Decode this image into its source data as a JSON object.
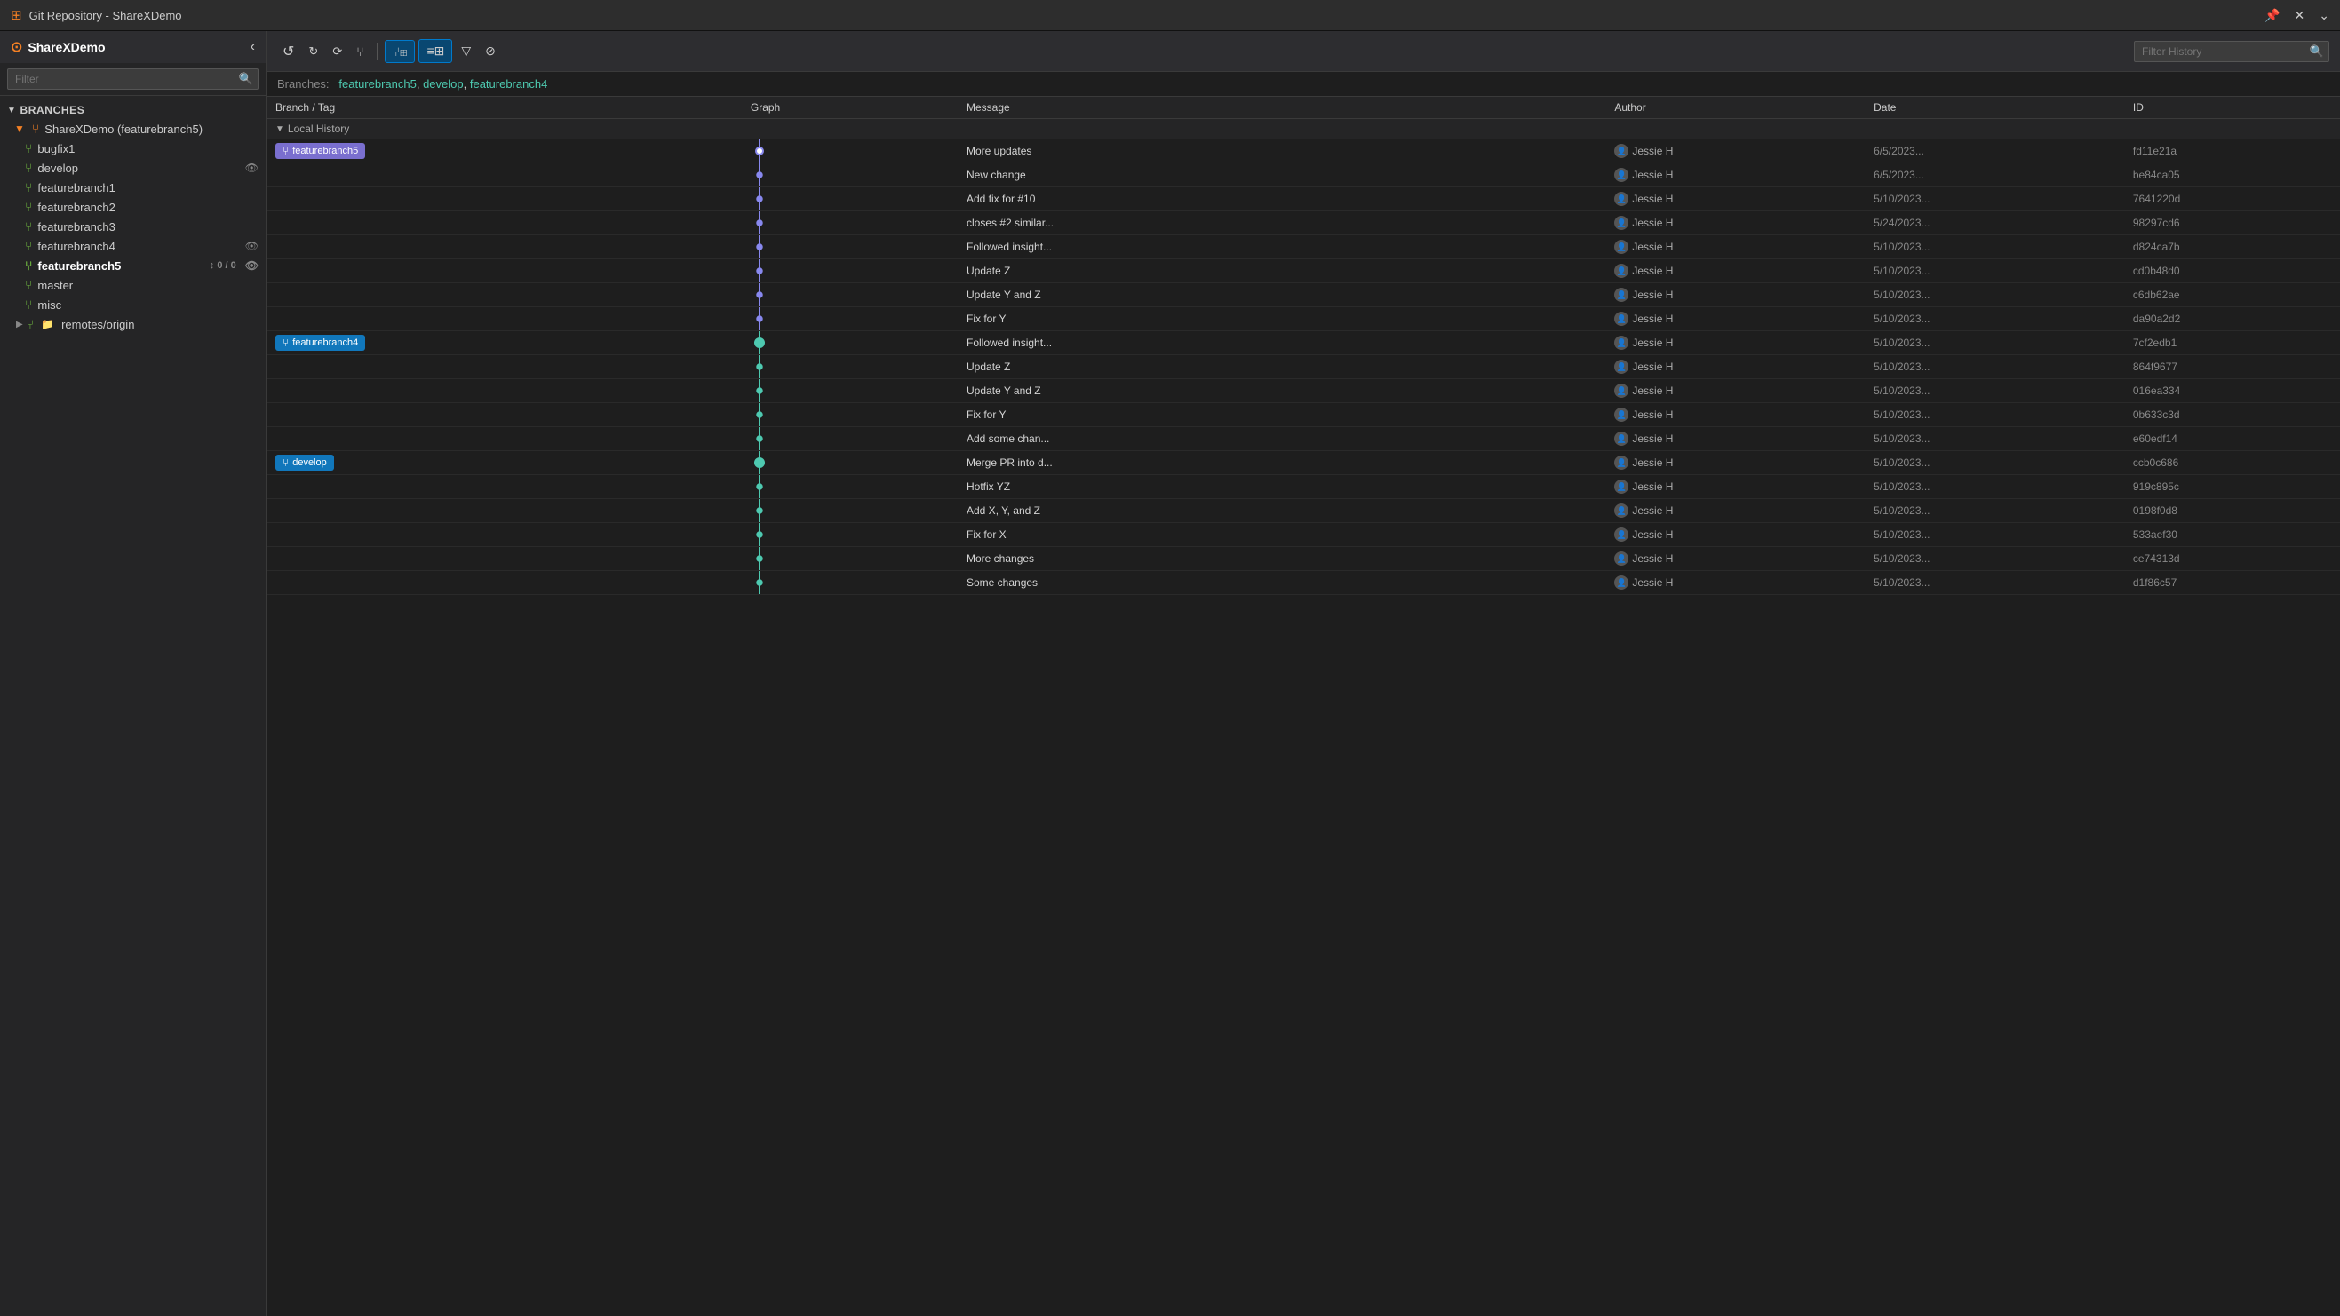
{
  "titleBar": {
    "icon": "⊞",
    "title": "Git Repository - ShareXDemo",
    "pinIcon": "📌",
    "closeIcon": "✕",
    "expandIcon": "⌄"
  },
  "sidebar": {
    "repoName": "ShareXDemo",
    "filterPlaceholder": "Filter",
    "branchesLabel": "Branches",
    "branches": [
      {
        "name": "ShareXDemo (featurebranch5)",
        "indent": 0,
        "isRoot": true,
        "icon": "fork"
      },
      {
        "name": "bugfix1",
        "indent": 1,
        "icon": "fork"
      },
      {
        "name": "develop",
        "indent": 1,
        "icon": "fork",
        "hasEye": true
      },
      {
        "name": "featurebranch1",
        "indent": 1,
        "icon": "fork"
      },
      {
        "name": "featurebranch2",
        "indent": 1,
        "icon": "fork"
      },
      {
        "name": "featurebranch3",
        "indent": 1,
        "icon": "fork"
      },
      {
        "name": "featurebranch4",
        "indent": 1,
        "icon": "fork",
        "hasEye": true
      },
      {
        "name": "featurebranch5",
        "indent": 1,
        "icon": "fork",
        "active": true,
        "badge": "↕ 0 / 0",
        "hasEye": true
      },
      {
        "name": "master",
        "indent": 1,
        "icon": "fork"
      },
      {
        "name": "misc",
        "indent": 1,
        "icon": "fork"
      }
    ],
    "remotes": {
      "label": "remotes/origin",
      "icon": "fork-remote"
    }
  },
  "toolbar": {
    "buttons": [
      {
        "id": "refresh",
        "icon": "↺",
        "title": "Refresh",
        "active": false
      },
      {
        "id": "fetch",
        "icon": "⇅",
        "title": "Fetch",
        "active": false
      },
      {
        "id": "pull",
        "icon": "⇓",
        "title": "Pull",
        "active": false
      },
      {
        "id": "graph-view",
        "icon": "⌥",
        "title": "Graph View",
        "active": true
      },
      {
        "id": "list-view",
        "icon": "≡",
        "title": "List View",
        "active": true
      },
      {
        "id": "filter-btn",
        "icon": "▽",
        "title": "Filter",
        "active": false
      },
      {
        "id": "hide-btn",
        "icon": "⊘",
        "title": "Hide",
        "active": false
      }
    ],
    "filterHistoryPlaceholder": "Filter History"
  },
  "branchesBar": {
    "label": "Branches:",
    "branches": [
      "featurebranch5",
      "develop",
      "featurebranch4"
    ]
  },
  "table": {
    "headers": [
      "Branch / Tag",
      "Graph",
      "Message",
      "Author",
      "Date",
      "ID"
    ],
    "localHistoryLabel": "Local History",
    "rows": [
      {
        "branch": "featurebranch5",
        "isBranchTag": true,
        "message": "More updates",
        "author": "Jessie H",
        "date": "6/5/2023...",
        "id": "fd11e21a",
        "graphDot": true,
        "graphColor": "#7a7aff",
        "isFirst": true
      },
      {
        "branch": "",
        "message": "New change",
        "author": "Jessie H",
        "date": "6/5/2023...",
        "id": "be84ca05",
        "graphDot": false,
        "graphColor": "#7a7aff"
      },
      {
        "branch": "",
        "message": "Add fix for #10",
        "author": "Jessie H",
        "date": "5/10/2023...",
        "id": "7641220d",
        "graphDot": false,
        "graphColor": "#7a7aff"
      },
      {
        "branch": "",
        "message": "closes #2 similar...",
        "author": "Jessie H",
        "date": "5/24/2023...",
        "id": "98297cd6",
        "graphDot": false,
        "graphColor": "#7a7aff"
      },
      {
        "branch": "",
        "message": "Followed insight...",
        "author": "Jessie H",
        "date": "5/10/2023...",
        "id": "d824ca7b",
        "graphDot": false,
        "graphColor": "#7a7aff"
      },
      {
        "branch": "",
        "message": "Update Z",
        "author": "Jessie H",
        "date": "5/10/2023...",
        "id": "cd0b48d0",
        "graphDot": false,
        "graphColor": "#7a7aff"
      },
      {
        "branch": "",
        "message": "Update Y and Z",
        "author": "Jessie H",
        "date": "5/10/2023...",
        "id": "c6db62ae",
        "graphDot": false,
        "graphColor": "#7a7aff"
      },
      {
        "branch": "",
        "message": "Fix for Y",
        "author": "Jessie H",
        "date": "5/10/2023...",
        "id": "da90a2d2",
        "graphDot": false,
        "graphColor": "#7a7aff"
      },
      {
        "branch": "featurebranch4",
        "isBranchTag": true,
        "message": "Followed insight...",
        "author": "Jessie H",
        "date": "5/10/2023...",
        "id": "7cf2edb1",
        "graphDot": true,
        "graphColor": "#4ec9b0"
      },
      {
        "branch": "",
        "message": "Update Z",
        "author": "Jessie H",
        "date": "5/10/2023...",
        "id": "864f9677",
        "graphDot": false,
        "graphColor": "#4ec9b0"
      },
      {
        "branch": "",
        "message": "Update Y and Z",
        "author": "Jessie H",
        "date": "5/10/2023...",
        "id": "016ea334",
        "graphDot": false,
        "graphColor": "#4ec9b0"
      },
      {
        "branch": "",
        "message": "Fix for Y",
        "author": "Jessie H",
        "date": "5/10/2023...",
        "id": "0b633c3d",
        "graphDot": false,
        "graphColor": "#4ec9b0"
      },
      {
        "branch": "",
        "message": "Add some chan...",
        "author": "Jessie H",
        "date": "5/10/2023...",
        "id": "e60edf14",
        "graphDot": false,
        "graphColor": "#4ec9b0"
      },
      {
        "branch": "develop",
        "isBranchTag": true,
        "message": "Merge PR into d...",
        "author": "Jessie H",
        "date": "5/10/2023...",
        "id": "ccb0c686",
        "graphDot": true,
        "graphColor": "#4ec9b0"
      },
      {
        "branch": "",
        "message": "Hotfix YZ",
        "author": "Jessie H",
        "date": "5/10/2023...",
        "id": "919c895c",
        "graphDot": false,
        "graphColor": "#4ec9b0"
      },
      {
        "branch": "",
        "message": "Add X, Y, and Z",
        "author": "Jessie H",
        "date": "5/10/2023...",
        "id": "0198f0d8",
        "graphDot": false,
        "graphColor": "#4ec9b0"
      },
      {
        "branch": "",
        "message": "Fix for X",
        "author": "Jessie H",
        "date": "5/10/2023...",
        "id": "533aef30",
        "graphDot": false,
        "graphColor": "#4ec9b0"
      },
      {
        "branch": "",
        "message": "More changes",
        "author": "Jessie H",
        "date": "5/10/2023...",
        "id": "ce74313d",
        "graphDot": false,
        "graphColor": "#4ec9b0"
      },
      {
        "branch": "",
        "message": "Some changes",
        "author": "Jessie H",
        "date": "5/10/2023...",
        "id": "d1f86c57",
        "graphDot": false,
        "graphColor": "#4ec9b0"
      }
    ]
  }
}
